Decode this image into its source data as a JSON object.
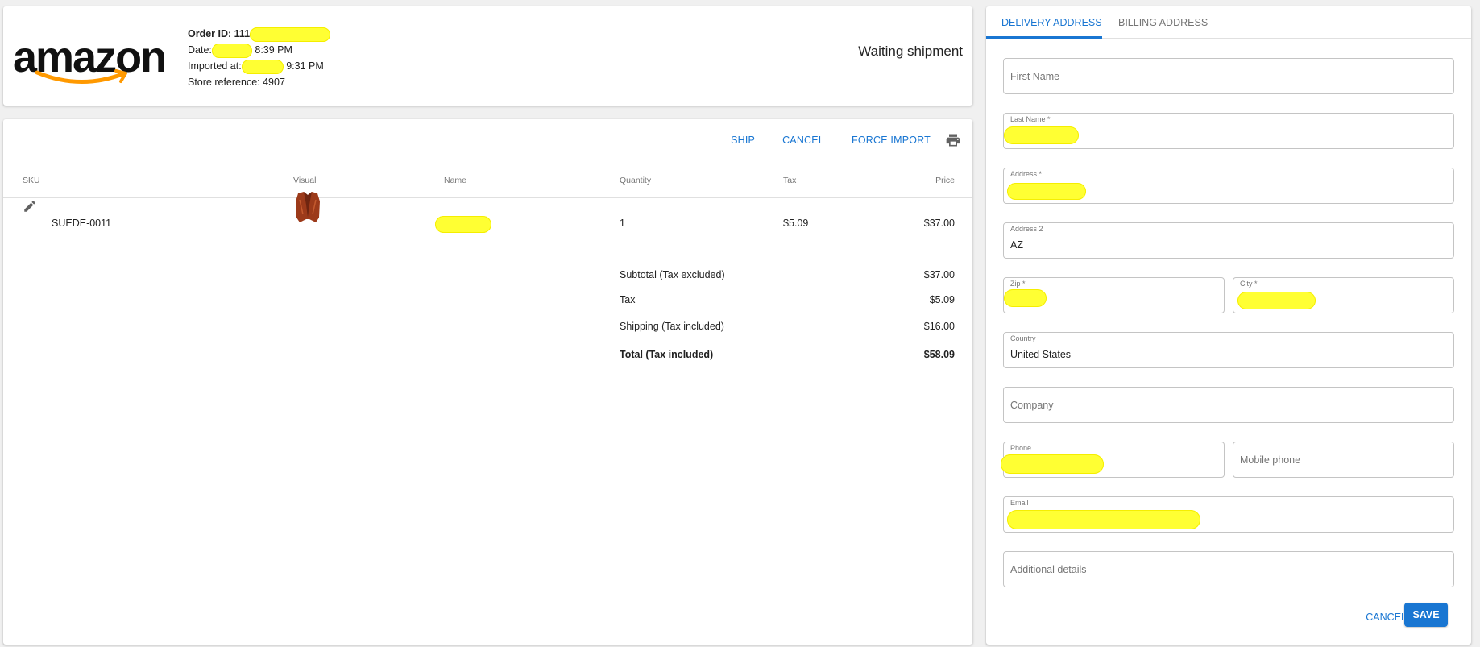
{
  "header": {
    "logo_text": "amazon",
    "order_id_label": "Order ID: 111",
    "date_label": "Date:",
    "date_time": "8:39 PM",
    "imported_label": "Imported at:",
    "imported_time": "9:31 PM",
    "store_reference": "Store reference: 4907",
    "status": "Waiting shipment"
  },
  "toolbar": {
    "ship": "SHIP",
    "cancel": "CANCEL",
    "force_import": "FORCE IMPORT",
    "print_icon": "printer-icon"
  },
  "table": {
    "columns": [
      "SKU",
      "Visual",
      "Name",
      "Quantity",
      "Tax",
      "Price"
    ],
    "rows": [
      {
        "sku": "SUEDE-0011",
        "quantity": "1",
        "tax": "$5.09",
        "price": "$37.00"
      }
    ]
  },
  "summary": {
    "subtotal_label": "Subtotal (Tax excluded)",
    "subtotal": "$37.00",
    "tax_label": "Tax",
    "tax": "$5.09",
    "shipping_label": "Shipping (Tax included)",
    "shipping": "$16.00",
    "total_label": "Total (Tax included)",
    "total": "$58.09"
  },
  "address": {
    "tabs": [
      "DELIVERY ADDRESS",
      "BILLING ADDRESS"
    ],
    "first_name_placeholder": "First Name",
    "last_name_label": "Last Name *",
    "address_label": "Address *",
    "address2_label": "Address 2",
    "address2_value": "AZ",
    "zip_label": "Zip *",
    "city_label": "City *",
    "country_label": "Country",
    "country_value": "United States",
    "company_placeholder": "Company",
    "phone_label": "Phone",
    "mobile_placeholder": "Mobile phone",
    "email_label": "Email",
    "details_placeholder": "Additional details",
    "cancel": "CANCEL",
    "save": "SAVE"
  },
  "colors": {
    "accent": "#1976d2",
    "redaction": "#ffff33",
    "amazon_smile": "#ff9900"
  }
}
